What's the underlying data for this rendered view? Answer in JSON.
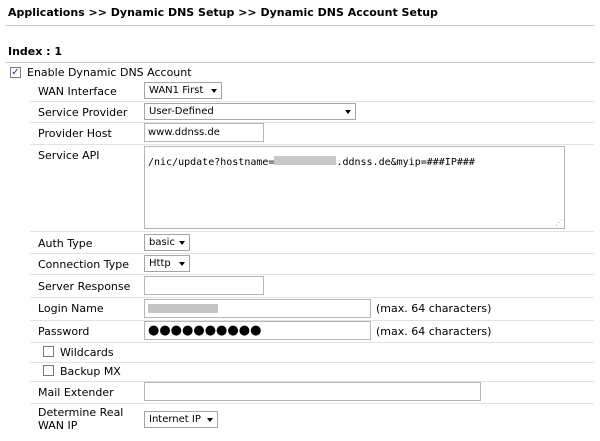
{
  "breadcrumb": "Applications >> Dynamic DNS Setup >> Dynamic DNS Account Setup",
  "index_label": "Index : 1",
  "enable": {
    "label": "Enable Dynamic DNS Account",
    "checked": true
  },
  "wan_interface": {
    "label": "WAN Interface",
    "value": "WAN1 First"
  },
  "service_provider": {
    "label": "Service Provider",
    "value": "User-Defined"
  },
  "provider_host": {
    "label": "Provider Host",
    "value": "www.ddnss.de"
  },
  "service_api": {
    "label": "Service API",
    "value_prefix": "/nic/update?hostname=",
    "value_suffix": ".ddnss.de&myip=###IP###"
  },
  "auth_type": {
    "label": "Auth Type",
    "value": "basic"
  },
  "connection_type": {
    "label": "Connection Type",
    "value": "Http"
  },
  "server_response": {
    "label": "Server Response",
    "value": ""
  },
  "login_name": {
    "label": "Login Name",
    "value": "",
    "note": "(max. 64 characters)"
  },
  "password": {
    "label": "Password",
    "value": "●●●●●●●●●●",
    "note": "(max. 64 characters)"
  },
  "wildcards": {
    "label": "Wildcards",
    "checked": false
  },
  "backup_mx": {
    "label": "Backup MX",
    "checked": false
  },
  "mail_extender": {
    "label": "Mail Extender",
    "value": ""
  },
  "determine_wan_ip": {
    "label_line1": "Determine Real",
    "label_line2": "WAN IP",
    "value": "Internet IP"
  }
}
